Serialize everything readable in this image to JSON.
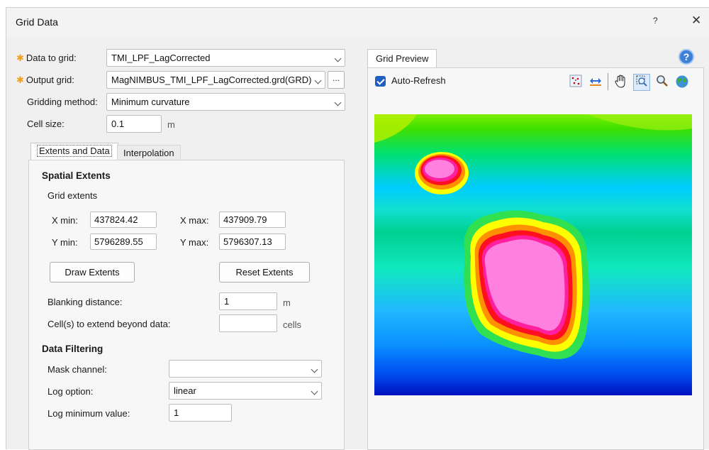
{
  "window": {
    "title": "Grid Data",
    "help_label": "?",
    "close_label": "✕"
  },
  "form": {
    "data_to_grid": {
      "label": "Data to grid:",
      "value": "TMI_LPF_LagCorrected"
    },
    "output_grid": {
      "label": "Output grid:",
      "value": "MagNIMBUS_TMI_LPF_LagCorrected.grd(GRD)",
      "browse_label": "..."
    },
    "gridding_method": {
      "label": "Gridding method:",
      "value": "Minimum curvature"
    },
    "cell_size": {
      "label": "Cell size:",
      "value": "0.1",
      "unit": "m"
    },
    "required_marker": "✱"
  },
  "tabs": [
    {
      "label": "Extents and Data"
    },
    {
      "label": "Interpolation"
    }
  ],
  "extents": {
    "section_title": "Spatial Extents",
    "group_label": "Grid extents",
    "xmin": {
      "label": "X min:",
      "value": "437824.42"
    },
    "xmax": {
      "label": "X max:",
      "value": "437909.79"
    },
    "ymin": {
      "label": "Y min:",
      "value": "5796289.55"
    },
    "ymax": {
      "label": "Y max:",
      "value": "5796307.13"
    },
    "draw_button": "Draw Extents",
    "reset_button": "Reset Extents",
    "blanking": {
      "label": "Blanking distance:",
      "value": "1",
      "unit": "m"
    },
    "extend": {
      "label": "Cell(s) to extend beyond data:",
      "value": "",
      "unit": "cells"
    }
  },
  "filtering": {
    "section_title": "Data Filtering",
    "mask": {
      "label": "Mask channel:",
      "value": ""
    },
    "log_option": {
      "label": "Log option:",
      "value": "linear"
    },
    "log_min": {
      "label": "Log minimum value:",
      "value": "1"
    }
  },
  "preview": {
    "tab_label": "Grid Preview",
    "auto_refresh_label": "Auto-Refresh",
    "auto_refresh_checked": true,
    "toolbar_icons": [
      "grid-points-icon",
      "fit-width-icon",
      "pan-hand-icon",
      "zoom-region-icon",
      "zoom-icon",
      "globe-icon"
    ],
    "help_icon": "help-icon",
    "colors": {
      "background": "#00e060",
      "low": "#0030d0",
      "high": "#ff70d8",
      "mid": "#ffff00"
    }
  }
}
